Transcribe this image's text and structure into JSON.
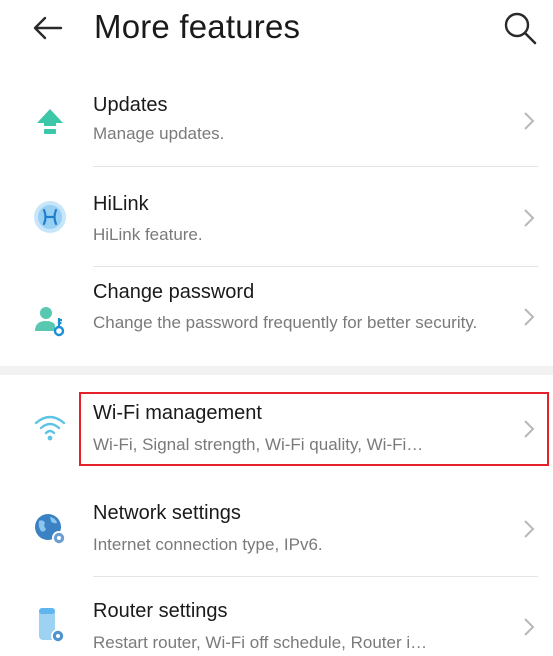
{
  "header": {
    "back_icon": "arrow-left-icon",
    "title": "More features",
    "search_icon": "search-icon"
  },
  "items": [
    {
      "title": "Updates",
      "subtitle": "Manage updates.",
      "icon": "arrow-up-icon",
      "color": "#3cc8a8"
    },
    {
      "title": "HiLink",
      "subtitle": "HiLink feature.",
      "icon": "hilink-icon",
      "color": "#5fb6ee"
    },
    {
      "title": "Change password",
      "subtitle": "Change the password frequently for better security.",
      "icon": "user-key-icon",
      "color": "#58c9b0"
    },
    {
      "title": "Wi-Fi management",
      "subtitle": "Wi-Fi, Signal strength, Wi-Fi quality, Wi-Fi…",
      "icon": "wifi-icon",
      "color": "#5ec4e6",
      "highlighted": true
    },
    {
      "title": "Network settings",
      "subtitle": "Internet connection type, IPv6.",
      "icon": "globe-gear-icon",
      "color": "#3b82c4"
    },
    {
      "title": "Router settings",
      "subtitle": "Restart router, Wi-Fi off schedule, Router i…",
      "icon": "router-gear-icon",
      "color": "#5fb6ee"
    }
  ],
  "colors": {
    "highlight": "#e5202a",
    "chevron": "#b8b8b8",
    "divider": "#e4e4e4"
  }
}
